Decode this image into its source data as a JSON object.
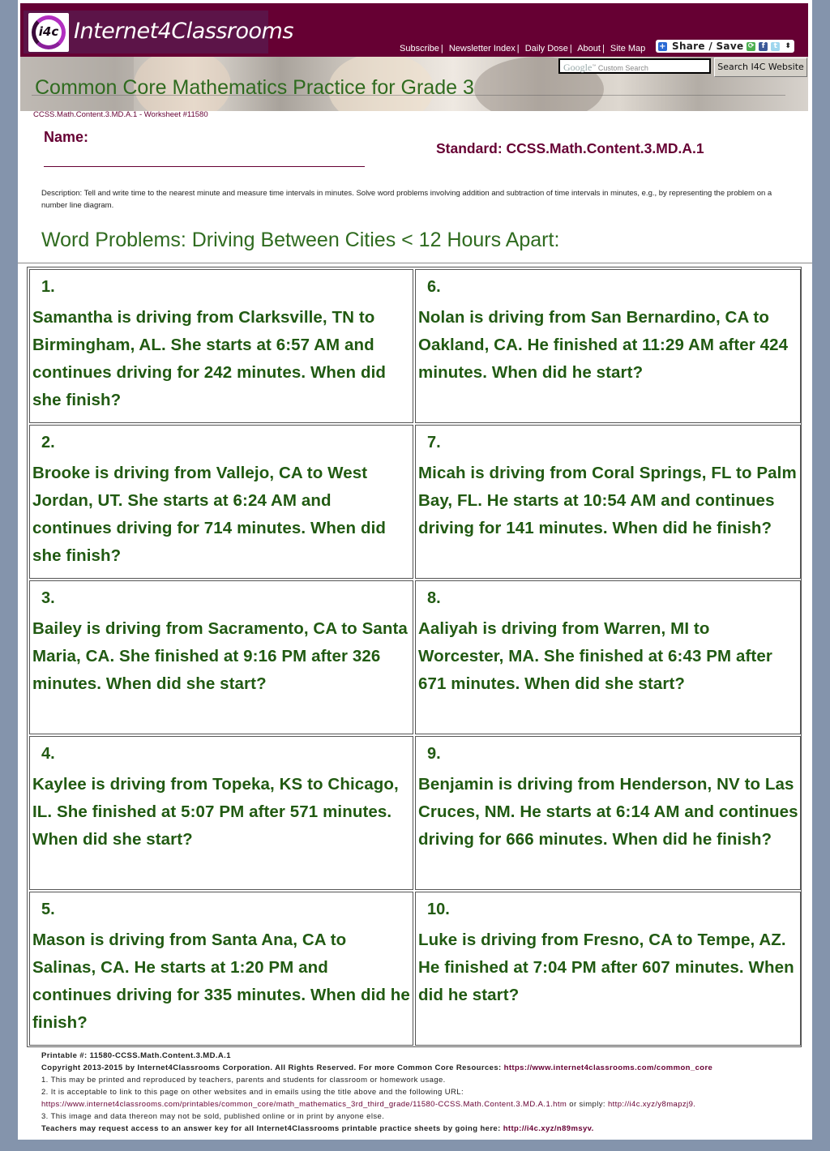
{
  "header": {
    "logo_mark": "i4c",
    "logo_text": "Internet4Classrooms",
    "nav": [
      "Subscribe",
      "Newsletter Index",
      "Daily Dose",
      "About",
      "Site Map"
    ],
    "nav_separator": "|",
    "share_label": "Share / Save",
    "search_placeholder_brand": "Google",
    "search_placeholder": "Custom Search",
    "search_button": "Search I4C Website",
    "page_title": "Common Core Mathematics Practice for Grade 3"
  },
  "colors": {
    "brand": "#660033",
    "title_green": "#2f6b1f",
    "problem_green": "#215a12",
    "page_bg": "#8494ac"
  },
  "worksheet": {
    "id_line": "CCSS.Math.Content.3.MD.A.1 - Worksheet #11580",
    "name_label": "Name:",
    "standard": "Standard: CCSS.Math.Content.3.MD.A.1",
    "description": "Description: Tell and write time to the nearest minute and measure time intervals in minutes. Solve word problems involving addition and subtraction of time intervals in minutes, e.g., by representing the problem on a number line diagram.",
    "section_title": "Word Problems: Driving Between Cities < 12 Hours Apart:"
  },
  "problems": [
    {
      "num": "1.",
      "text": "Samantha is driving from Clarksville, TN to Birmingham, AL. She starts at 6:57 AM and continues driving for 242 minutes. When did she finish?"
    },
    {
      "num": "6.",
      "text": "Nolan is driving from San Bernardino, CA to Oakland, CA. He finished at 11:29 AM after 424 minutes. When did he start?"
    },
    {
      "num": "2.",
      "text": "Brooke is driving from Vallejo, CA to West Jordan, UT. She starts at 6:24 AM and continues driving for 714 minutes. When did she finish?"
    },
    {
      "num": "7.",
      "text": "Micah is driving from Coral Springs, FL to Palm Bay, FL. He starts at 10:54 AM and continues driving for 141 minutes. When did he finish?"
    },
    {
      "num": "3.",
      "text": "Bailey is driving from Sacramento, CA to Santa Maria, CA. She finished at 9:16 PM after 326 minutes. When did she start?"
    },
    {
      "num": "8.",
      "text": "Aaliyah is driving from Warren, MI to Worcester, MA. She finished at 6:43 PM after 671 minutes. When did she start?"
    },
    {
      "num": "4.",
      "text": "Kaylee is driving from Topeka, KS to Chicago, IL. She finished at 5:07 PM after 571 minutes. When did she start?"
    },
    {
      "num": "9.",
      "text": "Benjamin is driving from Henderson, NV to Las Cruces, NM. He starts at 6:14 AM and continues driving for 666 minutes. When did he finish?"
    },
    {
      "num": "5.",
      "text": "Mason is driving from Santa Ana, CA to Salinas, CA. He starts at 1:20 PM and continues driving for 335 minutes. When did he finish?"
    },
    {
      "num": "10.",
      "text": "Luke is driving from Fresno, CA to Tempe, AZ. He finished at 7:04 PM after 607 minutes. When did he start?"
    }
  ],
  "footer": {
    "printable": "Printable #: 11580-CCSS.Math.Content.3.MD.A.1",
    "copyright": "Copyright 2013-2015 by Internet4Classrooms Corporation. All Rights Reserved. For more Common Core Resources: ",
    "copyright_link": "https://www.internet4classrooms.com/common_core",
    "note1": "1. This may be printed and reproduced by teachers, parents and students for classroom or homework usage.",
    "note2": "2. It is acceptable to link to this page on other websites and in emails using the title above and the following URL:",
    "note2_url": "https://www.internet4classrooms.com/printables/common_core/math_mathematics_3rd_third_grade/11580-CCSS.Math.Content.3.MD.A.1.htm",
    "note2_or": " or simply: ",
    "note2_short": "http://i4c.xyz/y8mapzj9.",
    "note3": "3. This image and data thereon may not be sold, published online or in print by anyone else.",
    "answer_key": "Teachers may request access to an answer key for all Internet4Classrooms printable practice sheets by going here: ",
    "answer_key_link": "http://i4c.xyz/n89msyv."
  }
}
